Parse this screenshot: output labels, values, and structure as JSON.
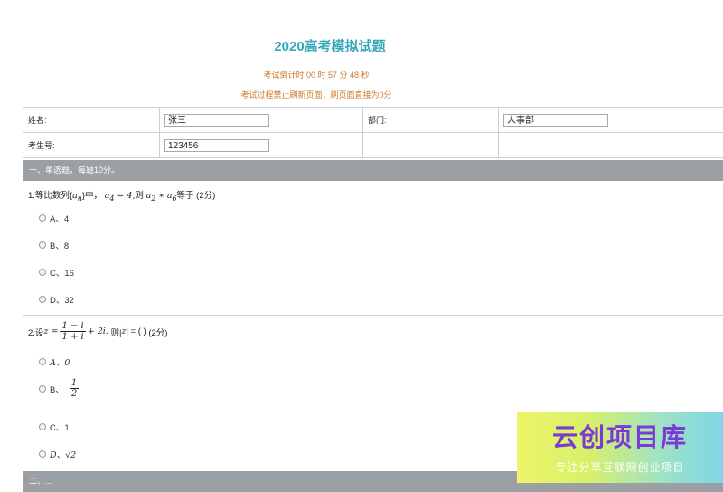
{
  "header": {
    "title": "2020高考模拟试题",
    "countdown": "考试倒计时 00 时 57 分 48 秒",
    "warning": "考试过程禁止刷新页面，刷页面直接为0分"
  },
  "form": {
    "name_label": "姓名:",
    "name_value": "张三",
    "dept_label": "部门:",
    "dept_value": "人事部",
    "id_label": "考生号:",
    "id_value": "123456"
  },
  "section1": {
    "title": "一、单选题，每题10分。"
  },
  "q1": {
    "prefix": "1.等比数列{",
    "seq_a": "a",
    "seq_sub": "n",
    "mid": "}中，",
    "cond": "a",
    "cond_sub": "4",
    "cond_val": " = 4,",
    "then": "则 ",
    "p1": "a",
    "p1_sub": "2",
    "times": " ∗ ",
    "p2": "a",
    "p2_sub": "6",
    "suffix": "等于 (2分)",
    "options": [
      "A、4",
      "B、8",
      "C、16",
      "D、32"
    ]
  },
  "q2": {
    "prefix": "2.设",
    "z_eq": "z =",
    "num": "1 − i",
    "den": "1 + i",
    "plus": "+ 2i.",
    "then": "则|",
    "abs_var": "z",
    "abs_end": "| = ( )",
    "score": "(2分)",
    "opt_a": "A、0",
    "opt_b": "B、",
    "opt_b_num": "1",
    "opt_b_den": "2",
    "opt_c": "C、1",
    "opt_d": "D、√2"
  },
  "section2": {
    "title": "二、..."
  },
  "watermark": {
    "title": "云创项目库",
    "subtitle": "专注分享互联网创业项目"
  }
}
